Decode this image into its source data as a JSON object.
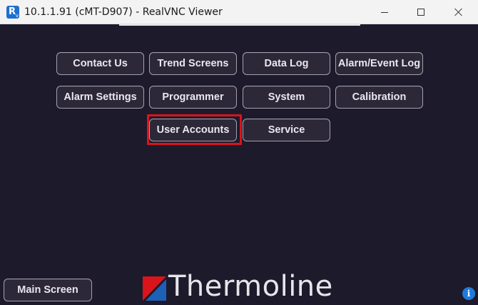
{
  "window": {
    "title": "10.1.1.91 (cMT-D907) - RealVNC Viewer",
    "icon": "realvnc-icon"
  },
  "menu": {
    "row1": [
      "Contact Us",
      "Trend Screens",
      "Data Log",
      "Alarm/Event Log"
    ],
    "row2": [
      "Alarm Settings",
      "Programmer",
      "System",
      "Calibration"
    ],
    "row3": [
      "User Accounts",
      "Service"
    ]
  },
  "highlighted_button": "User Accounts",
  "highlight_color": "#d9141b",
  "footer": {
    "main_screen_label": "Main Screen",
    "brand_name": "Thermoline",
    "info_icon_glyph": "i"
  },
  "colors": {
    "screen_background": "#1d1a2b",
    "button_background": "#2c2838",
    "brand_red": "#d9141b",
    "brand_blue": "#1e5fb8"
  }
}
